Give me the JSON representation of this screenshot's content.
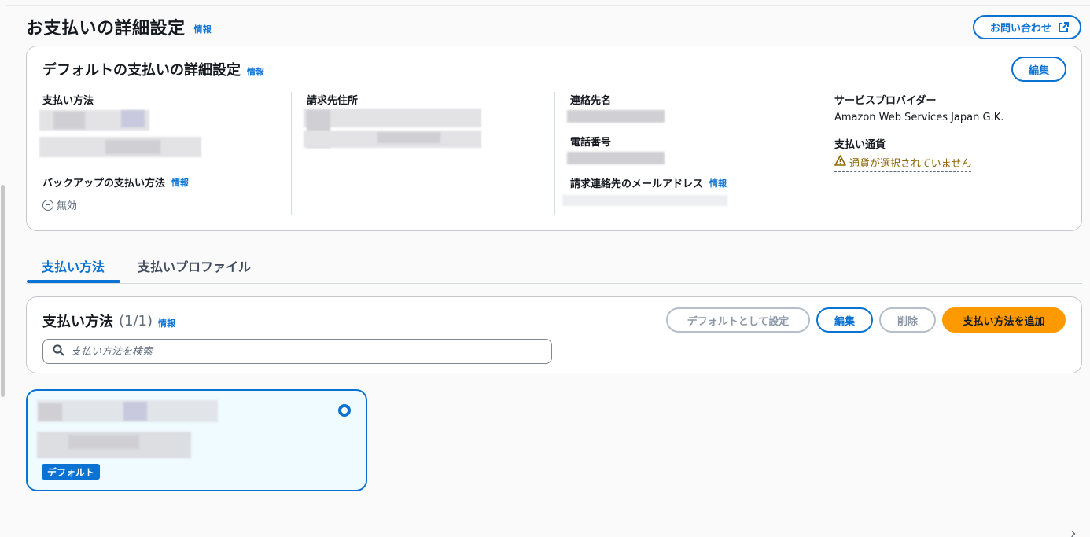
{
  "page": {
    "title": "お支払いの詳細設定",
    "info_label": "情報",
    "contact_button": "お問い合わせ"
  },
  "default_settings": {
    "title": "デフォルトの支払いの詳細設定",
    "info_label": "情報",
    "edit_button": "編集",
    "payment_method_label": "支払い方法",
    "backup_label": "バックアップの支払い方法",
    "backup_info": "情報",
    "backup_status": "無効",
    "billing_address_label": "請求先住所",
    "contact_name_label": "連絡先名",
    "phone_label": "電話番号",
    "billing_email_label": "請求連絡先のメールアドレス",
    "billing_email_info": "情報",
    "service_provider_label": "サービスプロバイダー",
    "service_provider_value": "Amazon Web Services Japan G.K.",
    "currency_label": "支払い通貨",
    "currency_warning": "通貨が選択されていません"
  },
  "tabs": [
    {
      "label": "支払い方法",
      "active": true
    },
    {
      "label": "支払いプロファイル",
      "active": false
    }
  ],
  "payment_methods": {
    "title": "支払い方法",
    "count": "(1/1)",
    "info_label": "情報",
    "set_default_button": "デフォルトとして設定",
    "edit_button": "編集",
    "delete_button": "削除",
    "add_button": "支払い方法を追加",
    "search_placeholder": "支払い方法を検索",
    "items": [
      {
        "badge": "デフォルト",
        "selected": true
      }
    ]
  },
  "colors": {
    "accent": "#0972d3",
    "primary_button": "#ff9900",
    "warning": "#8d6605"
  },
  "icons": [
    "external-link-icon",
    "minus-circle-icon",
    "warning-icon",
    "search-icon",
    "radio-selected-icon"
  ]
}
